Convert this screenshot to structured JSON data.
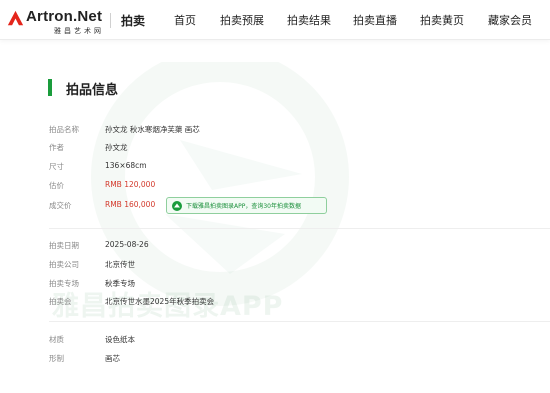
{
  "brand": {
    "name": "Artron.Net",
    "subtitle": "雅昌艺术网",
    "section": "拍卖"
  },
  "nav": {
    "items": [
      {
        "label": "首页"
      },
      {
        "label": "拍卖预展"
      },
      {
        "label": "拍卖结果"
      },
      {
        "label": "拍卖直播"
      },
      {
        "label": "拍卖黄页"
      },
      {
        "label": "藏家会员"
      }
    ]
  },
  "watermark": {
    "text": "雅昌拍卖图录APP"
  },
  "lot": {
    "heading": "拍品信息",
    "fields": [
      {
        "label": "拍品名称",
        "value": "孙文龙 秋水寒烟净芙蕖 画芯"
      },
      {
        "label": "作者",
        "value": "孙文龙"
      },
      {
        "label": "尺寸",
        "value": "136×68cm"
      },
      {
        "label": "估价",
        "value": "RMB 120,000"
      },
      {
        "label": "成交价",
        "value": "RMB 160,000"
      },
      {
        "label": "拍卖日期",
        "value": "2025-08-26"
      },
      {
        "label": "拍卖公司",
        "value": "北京传世"
      },
      {
        "label": "拍卖专场",
        "value": "秋季专场"
      },
      {
        "label": "拍卖会",
        "value": "北京传世水墨2025年秋季拍卖会"
      },
      {
        "label": "材质",
        "value": "设色纸本"
      },
      {
        "label": "形制",
        "value": "画芯"
      }
    ],
    "promo": "下载雅昌拍卖图录APP，查询30年拍卖数据"
  },
  "colors": {
    "accent": "#1a9c3c",
    "price": "#d33a2c",
    "logo_red": "#e4251b"
  }
}
